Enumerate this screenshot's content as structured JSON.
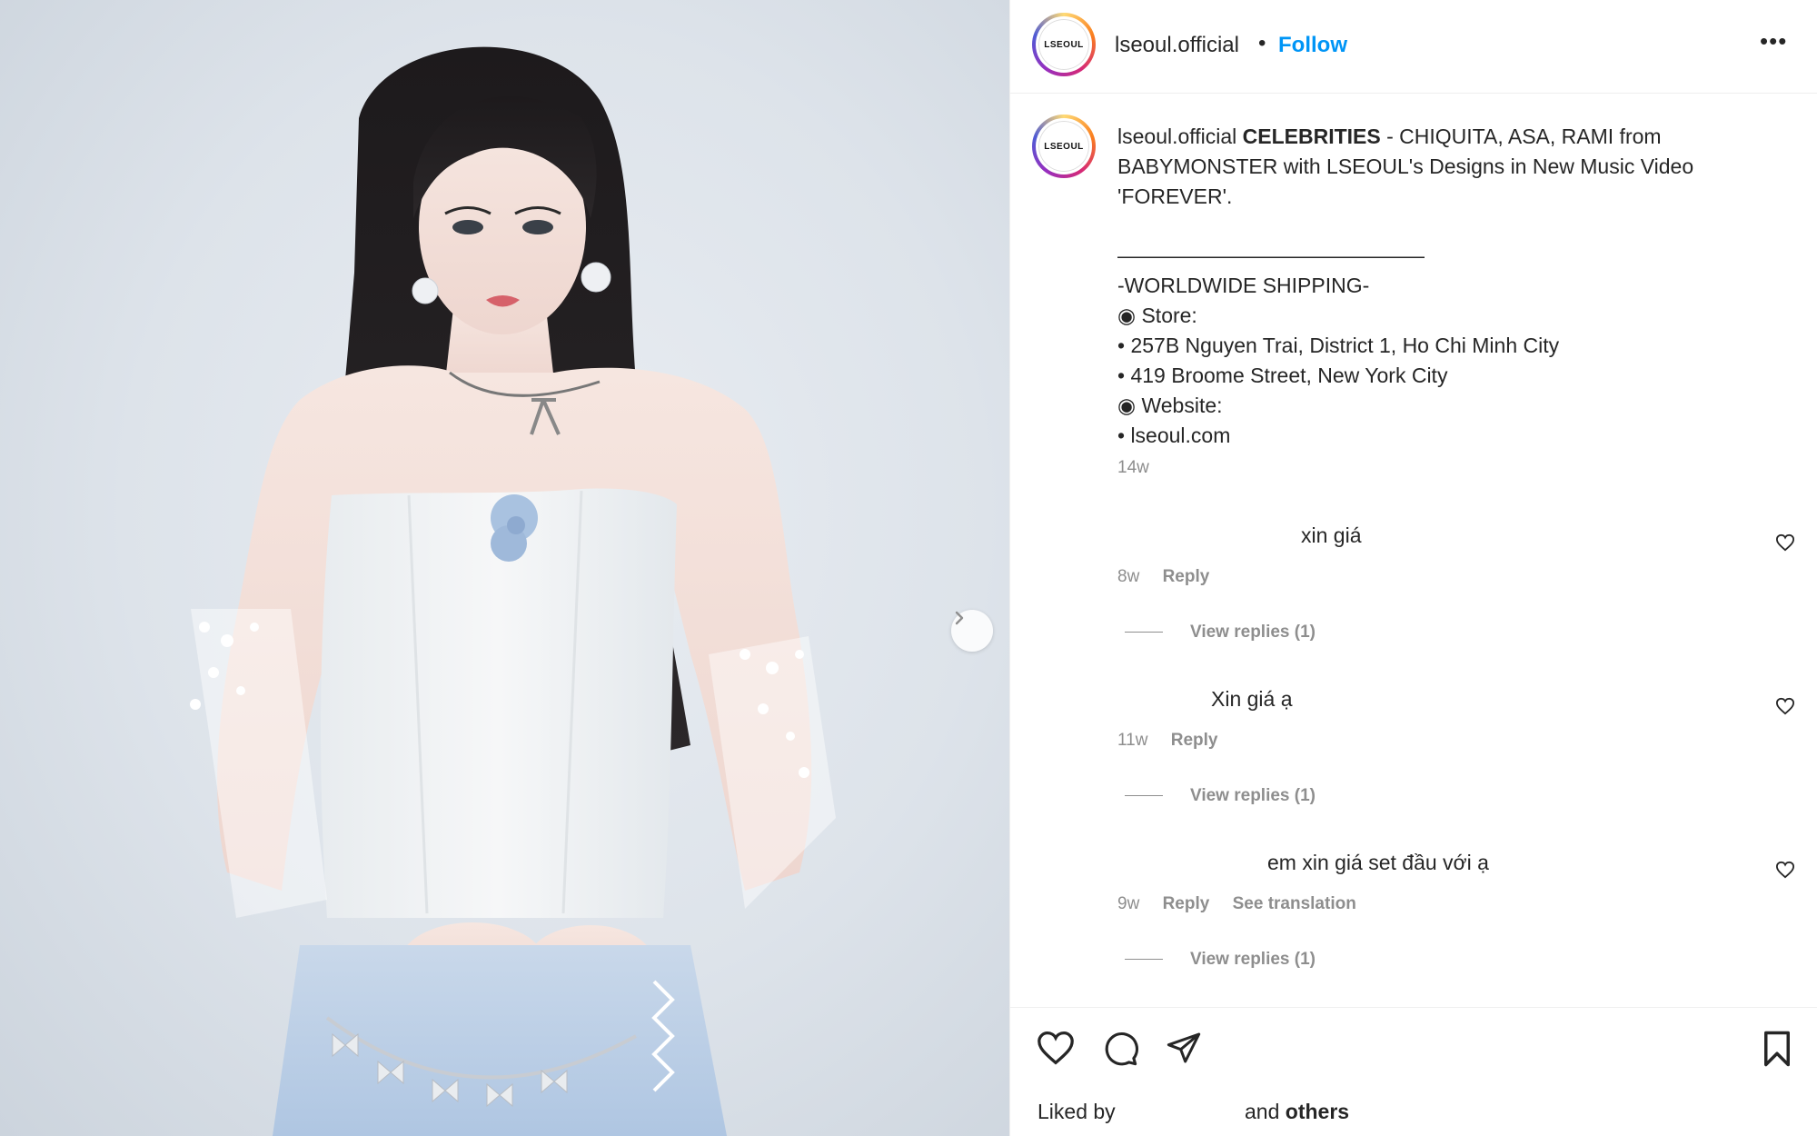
{
  "post": {
    "username": "lseoul.official",
    "separator": "•",
    "follow_label": "Follow",
    "more_label": "•••",
    "avatar_text": "LSEOUL"
  },
  "caption": {
    "username": "lseoul.official",
    "headline_bold": "CELEBRITIES",
    "headline_rest": " - CHIQUITA, ASA, RAMI from BABYMONSTER with LSEOUL's Designs in New Music Video 'FOREVER'.",
    "divider": "————————————————",
    "lines": [
      "-WORLDWIDE SHIPPING-",
      "◉ Store:",
      "• 257B Nguyen Trai, District 1, Ho Chi Minh City",
      "• 419 Broome Street, New York City",
      "◉ Website:",
      "• lseoul.com"
    ],
    "timestamp": "14w"
  },
  "comments": [
    {
      "text": "xin giá",
      "time": "8w",
      "reply_label": "Reply",
      "translate_label": "",
      "view_replies": "View replies (1)"
    },
    {
      "text": "Xin giá ạ",
      "time": "11w",
      "reply_label": "Reply",
      "translate_label": "",
      "view_replies": "View replies (1)"
    },
    {
      "text": "em xin giá set đầu với ạ",
      "time": "9w",
      "reply_label": "Reply",
      "translate_label": "See translation",
      "view_replies": "View replies (1)"
    }
  ],
  "footer": {
    "liked_by": "Liked by",
    "and_label": "and",
    "others_label": "others"
  },
  "icons": {
    "like": "heart-icon",
    "comment": "comment-icon",
    "share": "share-icon",
    "save": "bookmark-icon",
    "next": "chevron-right-icon",
    "more": "more-icon"
  },
  "colors": {
    "link_blue": "#0095f6",
    "text": "#262626",
    "muted": "#8e8e8e",
    "dress_blue": "#b9cde6"
  }
}
